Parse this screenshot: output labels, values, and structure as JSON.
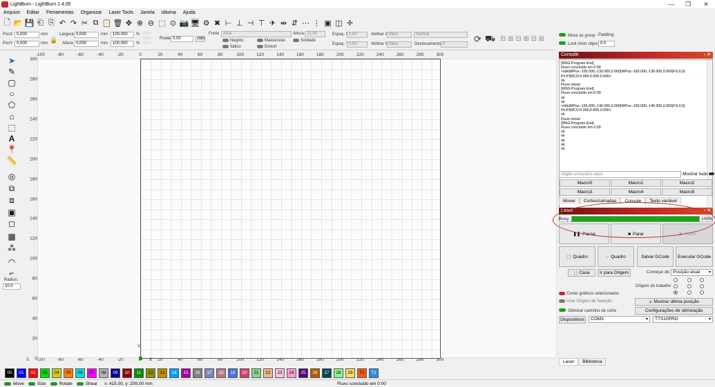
{
  "window": {
    "title": "LightBurn - LightBurn 1.4.05"
  },
  "menu": [
    "Arquivo",
    "Editar",
    "Ferramentas",
    "Organizar",
    "Laser Tools",
    "Janela",
    "Idioma",
    "Ajuda"
  ],
  "props": {
    "posx_label": "PosX",
    "posx": "0,000",
    "posy_label": "PosY",
    "posy": "0,000",
    "unit": "mm",
    "width_label": "Largura",
    "width": "0,000",
    "height_label": "Altura",
    "height": "0,000",
    "scale_x": "100,000",
    "scale_y": "100,000",
    "pct": "%",
    "rotate_label": "Rodar",
    "rotate": "0,00",
    "mm_btn": "mm",
    "font_label": "Fonte",
    "font": "Arial",
    "fheight_label": "Altura",
    "fheight": "25,00",
    "hspace_label": "Espaç. H",
    "hspace": "0,00",
    "vspace_label": "Espaç. V",
    "vspace": "0,00",
    "alignx_label": "Alinhar X",
    "alignx": "Meio",
    "aligny_label": "Alinhar Y",
    "aligny": "Meio",
    "normal": "Normal",
    "offset_label": "Deslocamento",
    "offset": "0",
    "bold": "Negrito",
    "italic": "Itálico",
    "upper": "Maiúsculas",
    "distort": "Distort",
    "welded": "Soldado"
  },
  "right_top": {
    "move_group": "Move as group",
    "lock_inner": "Lock inner objects",
    "padding_label": "Padding:",
    "padding": "0.0"
  },
  "left_tools": {
    "radius_label": "Radius:",
    "radius": "10.0"
  },
  "rulers": {
    "top": [
      "-100",
      "-80",
      "-60",
      "-40",
      "-20",
      "0",
      "20",
      "40",
      "60",
      "80",
      "100",
      "120",
      "140",
      "160",
      "180",
      "200",
      "220",
      "240",
      "260",
      "280",
      "300"
    ],
    "left": [
      "300",
      "280",
      "260",
      "240",
      "220",
      "200",
      "180",
      "160",
      "140",
      "120",
      "100",
      "80",
      "60",
      "40",
      "20",
      "0"
    ],
    "bottom": [
      "0",
      "-100",
      "-80",
      "-60",
      "-40",
      "-20",
      "0",
      "20",
      "40",
      "60",
      "80",
      "100",
      "120",
      "140",
      "160",
      "180",
      "200",
      "220",
      "240",
      "260",
      "280",
      "300"
    ],
    "origin_y": "Y",
    "origin_x": "X"
  },
  "console": {
    "title": "Console",
    "log": [
      "[MSG:Program End]",
      "Fluxo concluído em 0:00",
      "<Idle|MPos:-165.000,-130.000,0.000|WPos:-165.000,-130.000,0.000|FS:0,0|",
      "Pn:P|WCO:0.000,0.000,0.000>",
      "ok",
      "Fluxo inicial",
      "[MSG:Program End]",
      "Fluxo concluído em 0:00",
      "ok",
      "ok",
      "<Idle|MPos:-165.000,-140.000,0.000|WPos:-165.000,-140.000,0.000|FS:0,5|",
      "Pn:P|WCO:0.000,0.000,0.000>",
      "ok",
      "Fluxo inicial",
      "[MSG:Program End]",
      "Fluxo concluído em 0:00",
      "ok",
      "ok",
      "ok",
      "ok",
      "ok"
    ],
    "cmd_placeholder": "(digite comandos aqui)",
    "show_all": "Mostrar tudo",
    "macros": [
      "Macro0",
      "Macro1",
      "Macro2",
      "Macro3",
      "Macro4",
      "Macro5"
    ]
  },
  "tabs1": [
    "Mover",
    "Cortes/camadas",
    "Console",
    "Texto variável"
  ],
  "laser": {
    "title": "Laser",
    "status": "Busy",
    "progress_pct": 100,
    "progress_text": "100%",
    "pause": "Pausa",
    "stop": "Parar",
    "start": "Início",
    "frame1": "Quadro",
    "frame2": "Quadro",
    "save_gcode": "Salvar GCode",
    "run_gcode": "Executar GCode",
    "home": "Casa",
    "go_origin": "Ir para Origem",
    "start_from_label": "Começar de:",
    "start_from": "Posição atual",
    "job_origin_label": "Origem do trabalho",
    "cut_selected": "Cortar gráficos selecionados",
    "use_origin": "Usar Origem de Seleção",
    "optimize": "Otimizar caminho de corte",
    "show_last": "Mostrar última posição",
    "opt_settings": "Configurações de otimização",
    "devices": "Dispositivos",
    "port": "COM3",
    "device": "TTS10PRO"
  },
  "bottom_tabs": [
    "Laser",
    "Biblioteca"
  ],
  "palette": [
    {
      "t": "00",
      "c": "#000000",
      "f": "#ffffff"
    },
    {
      "t": "01",
      "c": "#0000ff",
      "f": "#ffffff"
    },
    {
      "t": "02",
      "c": "#ff0000",
      "f": "#ffffff"
    },
    {
      "t": "03",
      "c": "#00e000",
      "f": "#000000"
    },
    {
      "t": "04",
      "c": "#d0d000",
      "f": "#000000"
    },
    {
      "t": "05",
      "c": "#ff8000",
      "f": "#000000"
    },
    {
      "t": "06",
      "c": "#00e0e0",
      "f": "#000000"
    },
    {
      "t": "07",
      "c": "#ff00ff",
      "f": "#000000"
    },
    {
      "t": "08",
      "c": "#b4b4b4",
      "f": "#000000"
    },
    {
      "t": "09",
      "c": "#000090",
      "f": "#ffffff"
    },
    {
      "t": "10",
      "c": "#900000",
      "f": "#ffffff"
    },
    {
      "t": "11",
      "c": "#009000",
      "f": "#ffffff"
    },
    {
      "t": "12",
      "c": "#909000",
      "f": "#000000"
    },
    {
      "t": "13",
      "c": "#c09000",
      "f": "#000000"
    },
    {
      "t": "14",
      "c": "#00a0ff",
      "f": "#ffffff"
    },
    {
      "t": "15",
      "c": "#a000a0",
      "f": "#ffffff"
    },
    {
      "t": "16",
      "c": "#808080",
      "f": "#ffffff"
    },
    {
      "t": "17",
      "c": "#7d87b9",
      "f": "#ffffff"
    },
    {
      "t": "18",
      "c": "#bb7784",
      "f": "#ffffff"
    },
    {
      "t": "19",
      "c": "#4a6fe3",
      "f": "#ffffff"
    },
    {
      "t": "20",
      "c": "#d33f6a",
      "f": "#ffffff"
    },
    {
      "t": "21",
      "c": "#8cd78c",
      "f": "#000000"
    },
    {
      "t": "22",
      "c": "#f0b98d",
      "f": "#000000"
    },
    {
      "t": "23",
      "c": "#f6c4e1",
      "f": "#000000"
    },
    {
      "t": "24",
      "c": "#fa9ed4",
      "f": "#000000"
    },
    {
      "t": "25",
      "c": "#500a78",
      "f": "#ffffff"
    },
    {
      "t": "26",
      "c": "#b45a00",
      "f": "#ffffff"
    },
    {
      "t": "27",
      "c": "#004754",
      "f": "#ffffff"
    },
    {
      "t": "28",
      "c": "#86fa88",
      "f": "#000000"
    },
    {
      "t": "29",
      "c": "#ffdb66",
      "f": "#000000"
    },
    {
      "t": "T1",
      "c": "#f35b13",
      "f": "#000000"
    },
    {
      "t": "T2",
      "c": "#2c8ed6",
      "f": "#ffffff"
    }
  ],
  "status": {
    "move": "Move",
    "size": "Size",
    "rotate": "Rotate",
    "shear": "Shear",
    "coords": "x: 415,00, y: 209,00 mm",
    "message": "Fluxo concluído em 0:00"
  },
  "colors": {
    "accent": "#c62828",
    "progress": "#14a814",
    "toggle_on": "#1a9c1a"
  }
}
